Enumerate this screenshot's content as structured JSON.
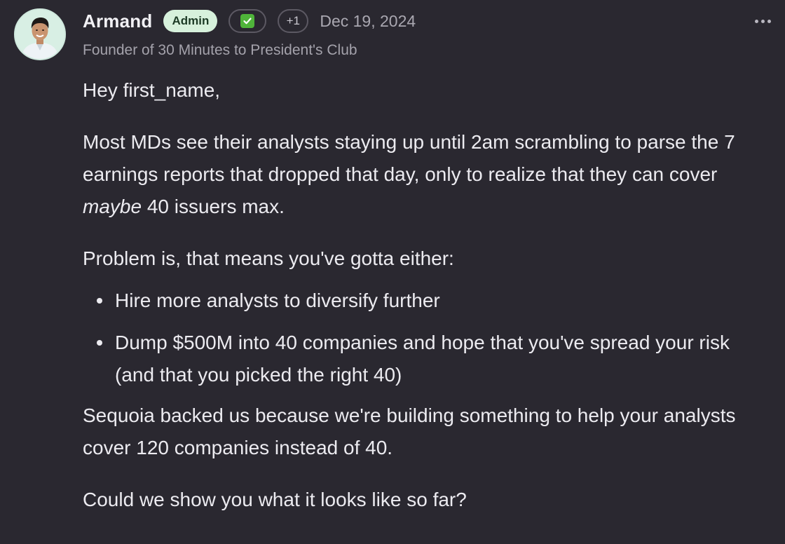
{
  "post": {
    "author": {
      "name": "Armand",
      "role_badge": "Admin",
      "extra_badges_count": "+1",
      "subtitle": "Founder of 30 Minutes to President's Club"
    },
    "date": "Dec 19, 2024",
    "more_icon": "more-horizontal-icon",
    "check_icon": "check-mark-icon",
    "colors": {
      "background": "#2a2830",
      "badge_bg": "#d7f1dc",
      "check_green": "#4fb43a"
    },
    "body": {
      "greeting": "Hey first_name,",
      "intro_before": "Most MDs see their analysts staying up until 2am scrambling to parse the 7 earnings reports that dropped that day, only to realize that they can cover ",
      "intro_emphasis": "maybe",
      "intro_after": " 40 issuers max.",
      "problem": "Problem is, that means you've gotta either:",
      "bullets": [
        "Hire more analysts to diversify further",
        "Dump $500M into 40 companies and hope that you've spread your risk (and that you picked the right 40)"
      ],
      "sequoia": "Sequoia backed us because we're building something to help your analysts cover 120 companies instead of 40.",
      "closing": "Could we show you what it looks like so far?"
    }
  }
}
